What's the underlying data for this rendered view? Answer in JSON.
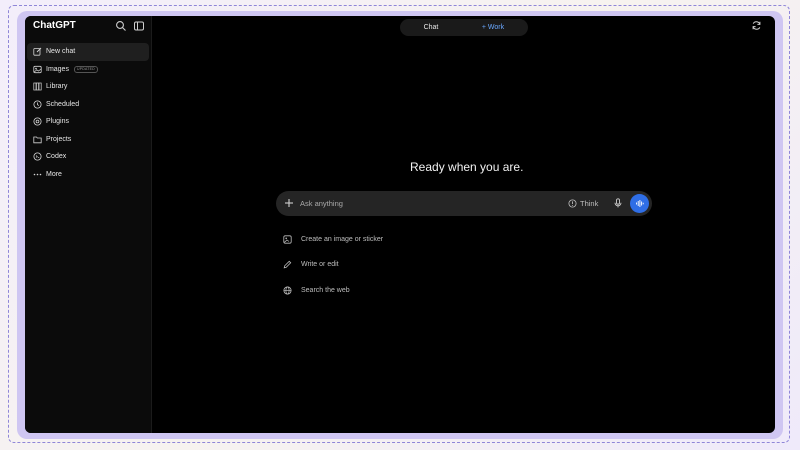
{
  "sidebar": {
    "brand": "ChatGPT",
    "items": [
      {
        "label": "New chat",
        "icon": "edit-icon"
      },
      {
        "label": "Images",
        "icon": "image-icon",
        "badge": "UPDATED"
      },
      {
        "label": "Library",
        "icon": "library-icon"
      },
      {
        "label": "Scheduled",
        "icon": "clock-icon"
      },
      {
        "label": "Plugins",
        "icon": "plugin-icon"
      },
      {
        "label": "Projects",
        "icon": "folder-icon"
      },
      {
        "label": "Codex",
        "icon": "codex-icon"
      },
      {
        "label": "More",
        "icon": "more-icon"
      }
    ]
  },
  "header": {
    "mode_chat": "Chat",
    "mode_work": "+ Work"
  },
  "main": {
    "headline": "Ready when you are.",
    "composer": {
      "placeholder": "Ask anything",
      "think_label": "Think"
    },
    "suggestions": [
      {
        "label": "Create an image or sticker",
        "icon": "image-sticker-icon"
      },
      {
        "label": "Write or edit",
        "icon": "pencil-icon"
      },
      {
        "label": "Search the web",
        "icon": "globe-icon"
      }
    ]
  },
  "colors": {
    "accent": "#2f6ee6",
    "work_mode": "#6aa8ff",
    "frame": "#cfc6f2"
  }
}
